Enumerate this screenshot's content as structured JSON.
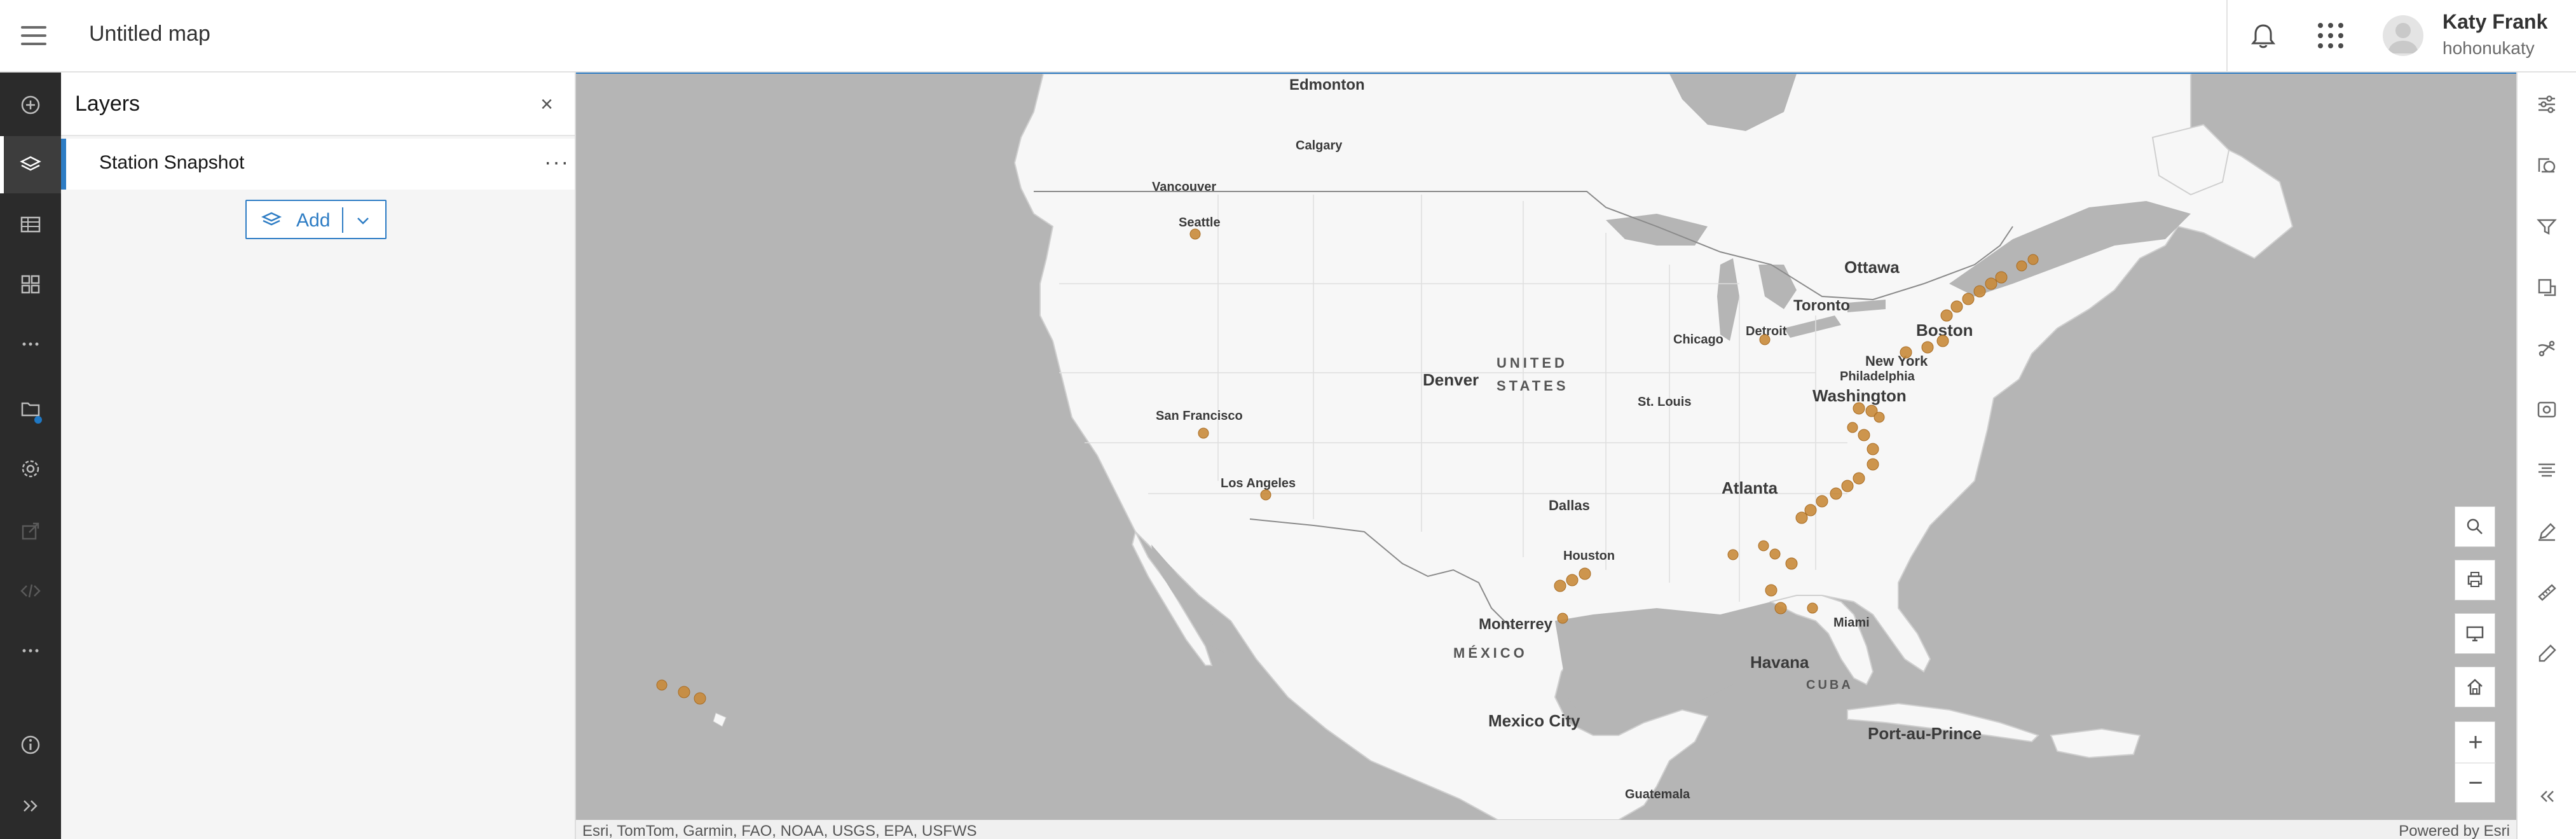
{
  "header": {
    "map_title": "Untitled map",
    "user_name": "Katy Frank",
    "user_handle": "hohonukaty"
  },
  "left_toolbar": {
    "items": [
      "add-icon",
      "layers-icon",
      "table-icon",
      "basemap-icon",
      "more-icon",
      "saved-icon",
      "settings-icon",
      "share-icon",
      "embed-icon",
      "more-icon",
      "info-icon",
      "expand-icon"
    ]
  },
  "layers_panel": {
    "title": "Layers",
    "layers": [
      {
        "name": "Station Snapshot"
      }
    ],
    "add_label": "Add"
  },
  "map": {
    "labels": {
      "edmonton": "Edmonton",
      "calgary": "Calgary",
      "vancouver": "Vancouver",
      "seattle": "Seattle",
      "ottawa": "Ottawa",
      "toronto": "Toronto",
      "boston": "Boston",
      "detroit": "Detroit",
      "chicago": "Chicago",
      "new_york": "New York",
      "philadelphia": "Philadelphia",
      "washington": "Washington",
      "denver": "Denver",
      "united": "UNITED",
      "states": "STATES",
      "st_louis": "St. Louis",
      "san_francisco": "San Francisco",
      "los_angeles": "Los Angeles",
      "atlanta": "Atlanta",
      "dallas": "Dallas",
      "houston": "Houston",
      "monterrey": "Monterrey",
      "mexico": "MÉXICO",
      "miami": "Miami",
      "havana": "Havana",
      "cuba": "CUBA",
      "mexico_city": "Mexico City",
      "port_au_prince": "Port-au-Prince",
      "guatemala": "Guatemala"
    },
    "attribution": "Esri, TomTom, Garmin, FAO, NOAA, USGS, EPA, USFWS",
    "powered_by": "Powered by Esri",
    "station_color": "#c8893a",
    "land_color": "#f7f7f7",
    "water_color": "#b5b5b5"
  },
  "map_controls": [
    "search-icon",
    "print-icon",
    "screen-icon",
    "home-icon"
  ],
  "zoom": {
    "in": "+",
    "out": "−"
  },
  "right_toolbar": {
    "items": [
      "properties-icon",
      "styles-icon",
      "filter-icon",
      "effects-icon",
      "analysis-icon",
      "media-icon",
      "labels-icon",
      "sketch-icon",
      "measure-icon",
      "configure-icon",
      "collapse-icon"
    ]
  }
}
